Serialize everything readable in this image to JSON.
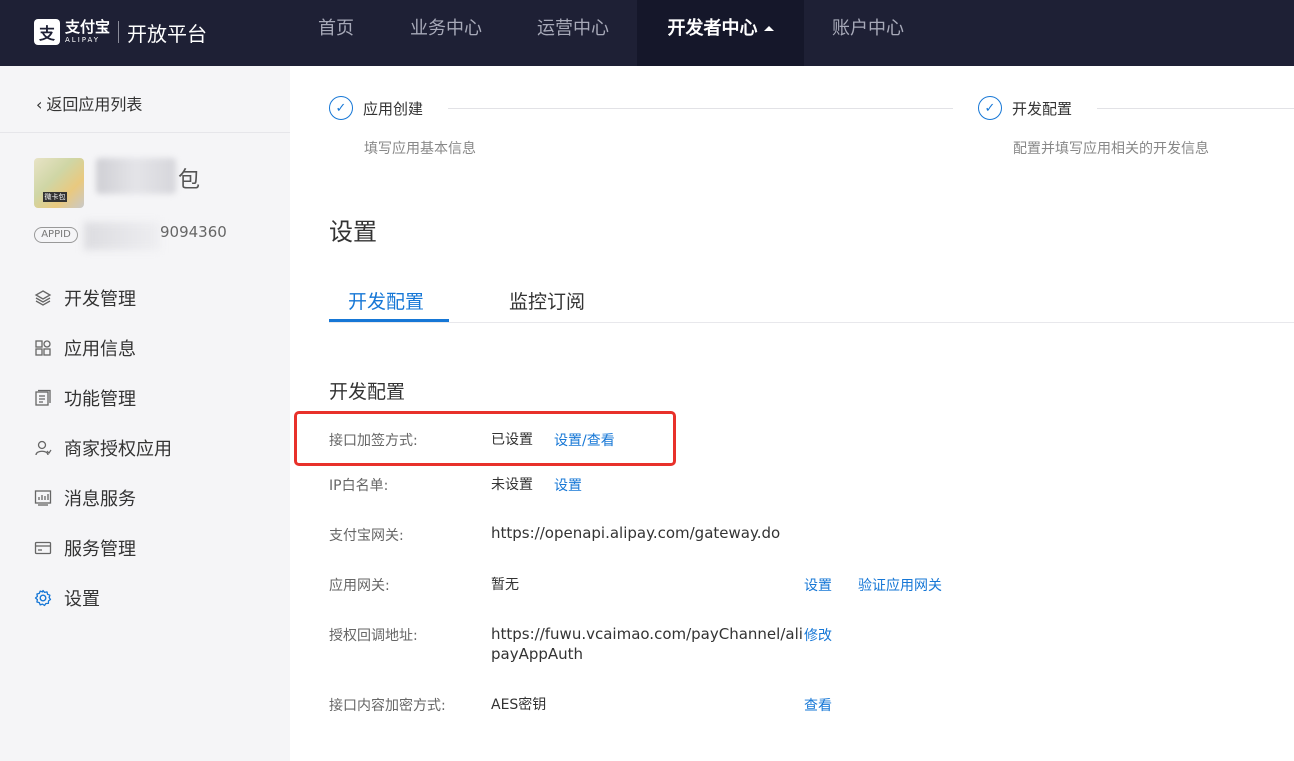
{
  "header": {
    "logo_mark": "支",
    "logo_cn": "支付宝",
    "logo_en": "ALIPAY",
    "platform": "开放平台",
    "nav": [
      "首页",
      "业务中心",
      "运营中心",
      "开发者中心",
      "账户中心"
    ]
  },
  "sidebar": {
    "back_label": "返回应用列表",
    "app_name_tail": "包",
    "app_logo_tag": "微卡包",
    "appid_badge": "APPID",
    "appid_tail": "9094360",
    "menu": [
      {
        "label": "开发管理",
        "icon": "layers-icon"
      },
      {
        "label": "应用信息",
        "icon": "grid-icon"
      },
      {
        "label": "功能管理",
        "icon": "document-icon"
      },
      {
        "label": "商家授权应用",
        "icon": "user-icon"
      },
      {
        "label": "消息服务",
        "icon": "chart-icon"
      },
      {
        "label": "服务管理",
        "icon": "card-icon"
      },
      {
        "label": "设置",
        "icon": "gear-icon"
      }
    ]
  },
  "steps": [
    {
      "title": "应用创建",
      "desc": "填写应用基本信息"
    },
    {
      "title": "开发配置",
      "desc": "配置并填写应用相关的开发信息"
    }
  ],
  "main": {
    "title": "设置",
    "tabs": [
      "开发配置",
      "监控订阅"
    ],
    "section_title": "开发配置",
    "rows": {
      "sign_label": "接口加签方式:",
      "sign_value": "已设置",
      "sign_link": "设置/查看",
      "ip_label": "IP白名单:",
      "ip_value": "未设置",
      "ip_link": "设置",
      "gateway_label": "支付宝网关:",
      "gateway_value": "https://openapi.alipay.com/gateway.do",
      "app_gateway_label": "应用网关:",
      "app_gateway_value": "暂无",
      "app_gateway_link1": "设置",
      "app_gateway_link2": "验证应用网关",
      "callback_label": "授权回调地址:",
      "callback_value": "https://fuwu.vcaimao.com/payChannel/alipayAppAuth",
      "callback_link": "修改",
      "encrypt_label": "接口内容加密方式:",
      "encrypt_value": "AES密钥",
      "encrypt_link": "查看"
    }
  },
  "colors": {
    "topbar": "#1e2035",
    "accent": "#1677d6",
    "highlight": "#e8312a"
  }
}
